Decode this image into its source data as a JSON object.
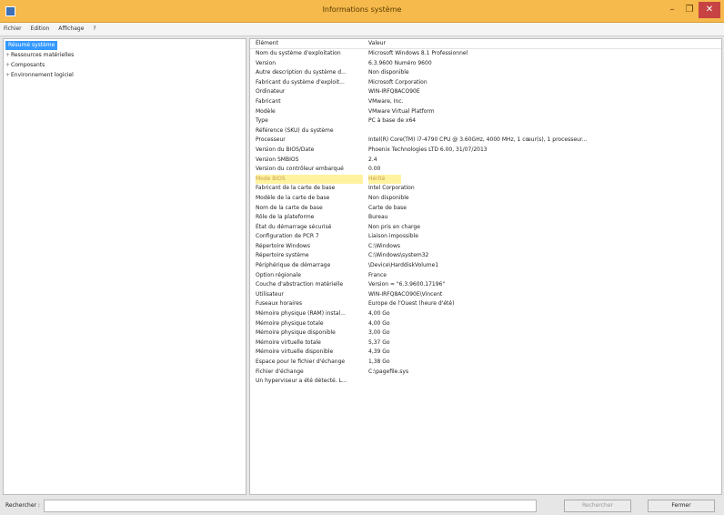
{
  "window": {
    "title": "Informations système"
  },
  "menu": {
    "items": [
      "Fichier",
      "Edition",
      "Affichage",
      "?"
    ]
  },
  "tree": [
    {
      "label": "Résumé système",
      "selected": true,
      "expander": ""
    },
    {
      "label": "Ressources matérielles",
      "selected": false,
      "expander": "+"
    },
    {
      "label": "Composants",
      "selected": false,
      "expander": "+"
    },
    {
      "label": "Environnement logiciel",
      "selected": false,
      "expander": "+"
    }
  ],
  "details": {
    "header": {
      "element": "Élément",
      "value": "Valeur"
    },
    "rows": [
      {
        "k": "Nom du système d'exploitation",
        "v": "Microsoft Windows 8.1 Professionnel"
      },
      {
        "k": "Version",
        "v": "6.3.9600 Numéro 9600"
      },
      {
        "k": "Autre description du système d...",
        "v": "Non disponible"
      },
      {
        "k": "Fabricant du système d'exploit...",
        "v": "Microsoft Corporation"
      },
      {
        "k": "Ordinateur",
        "v": "WIN-IRFQ8ACO90E"
      },
      {
        "k": "Fabricant",
        "v": "VMware, Inc."
      },
      {
        "k": "Modèle",
        "v": "VMware Virtual Platform"
      },
      {
        "k": "Type",
        "v": "PC à base de x64"
      },
      {
        "k": "Référence (SKU) du système",
        "v": ""
      },
      {
        "k": "Processeur",
        "v": "Intel(R) Core(TM) i7-4790 CPU @ 3.60GHz, 4000 MHz, 1 cœur(s), 1 processeur..."
      },
      {
        "k": "Version du BIOS/Date",
        "v": "Phoenix Technologies LTD 6.00, 31/07/2013"
      },
      {
        "k": "Version SMBIOS",
        "v": "2.4"
      },
      {
        "k": "Version du contrôleur embarqué",
        "v": "0.00"
      },
      {
        "k": "Mode BIOS",
        "v": "Hérité",
        "highlight": true
      },
      {
        "k": "Fabricant de la carte de base",
        "v": "Intel Corporation"
      },
      {
        "k": "Modèle de la carte de base",
        "v": "Non disponible"
      },
      {
        "k": "Nom de la carte de base",
        "v": "Carte de base"
      },
      {
        "k": "Rôle de la plateforme",
        "v": "Bureau"
      },
      {
        "k": "État du démarrage sécurisé",
        "v": "Non pris en charge"
      },
      {
        "k": "Configuration de PCR 7",
        "v": "Liaison impossible"
      },
      {
        "k": "Répertoire Windows",
        "v": "C:\\Windows"
      },
      {
        "k": "Répertoire système",
        "v": "C:\\Windows\\system32"
      },
      {
        "k": "Périphérique de démarrage",
        "v": "\\Device\\HarddiskVolume1"
      },
      {
        "k": "Option régionale",
        "v": "France"
      },
      {
        "k": "Couche d'abstraction matérielle",
        "v": "Version = \"6.3.9600.17196\""
      },
      {
        "k": "Utilisateur",
        "v": "WIN-IRFQ8ACO90E\\Vincent"
      },
      {
        "k": "Fuseaux horaires",
        "v": "Europe de l'Ouest (heure d'été)"
      },
      {
        "k": "Mémoire physique (RAM) instal...",
        "v": "4,00 Go"
      },
      {
        "k": "Mémoire physique totale",
        "v": "4,00 Go"
      },
      {
        "k": "Mémoire physique disponible",
        "v": "3,00 Go"
      },
      {
        "k": "Mémoire virtuelle totale",
        "v": "5,37 Go"
      },
      {
        "k": "Mémoire virtuelle disponible",
        "v": "4,39 Go"
      },
      {
        "k": "Espace pour le fichier d'échange",
        "v": "1,38 Go"
      },
      {
        "k": "Fichier d'échange",
        "v": "C:\\pagefile.sys"
      },
      {
        "k": "Un hyperviseur a été détecté. L...",
        "v": ""
      }
    ]
  },
  "bottom": {
    "search_label": "Rechercher :",
    "search_value": "",
    "find_button": "Rechercher",
    "close_button": "Fermer"
  },
  "colors": {
    "titlebar": "#f5b94c",
    "selection": "#3399ff",
    "highlight": "#fff3a0"
  }
}
